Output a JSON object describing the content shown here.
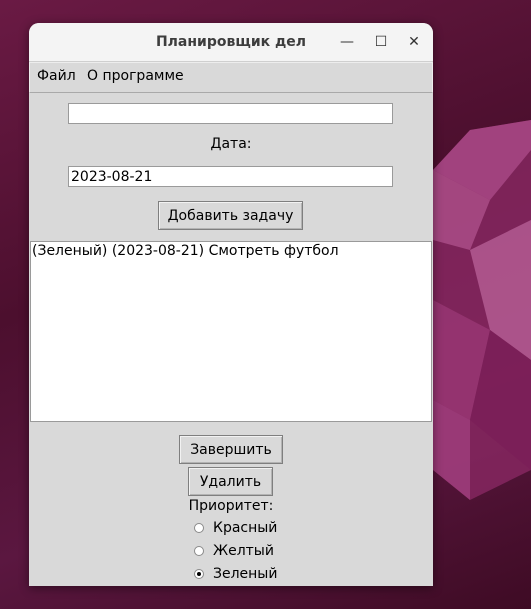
{
  "window": {
    "title": "Планировщик дел",
    "minimize_icon": "minimize-icon",
    "maximize_icon": "maximize-icon",
    "close_icon": "close-icon"
  },
  "menubar": {
    "items": [
      {
        "label": "Файл"
      },
      {
        "label": "О программе"
      }
    ]
  },
  "form": {
    "task_value": "",
    "date_label": "Дата:",
    "date_value": "2023-08-21",
    "add_button": "Добавить задачу"
  },
  "tasks": [
    {
      "text": "(Зеленый) (2023-08-21) Смотреть футбол"
    }
  ],
  "actions": {
    "complete_button": "Завершить",
    "delete_button": "Удалить"
  },
  "priority": {
    "label": "Приоритет:",
    "options": [
      {
        "label": "Красный",
        "checked": false
      },
      {
        "label": "Желтый",
        "checked": false
      },
      {
        "label": "Зеленый",
        "checked": true
      }
    ]
  },
  "colors": {
    "window_bg": "#d9d9d9",
    "titlebar_bg": "#f4f4f4",
    "desktop_bg": "#5a1436"
  }
}
